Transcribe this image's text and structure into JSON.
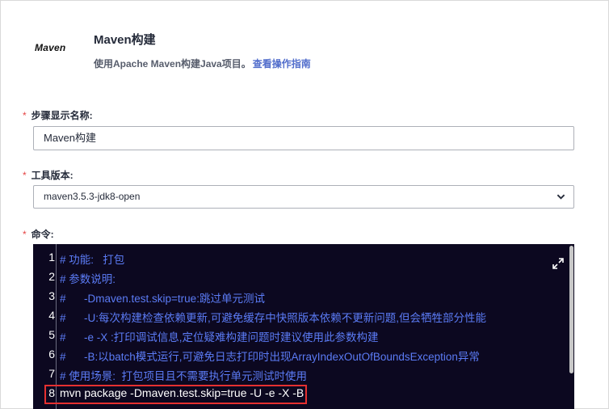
{
  "header": {
    "logo_text": "Maven",
    "title": "Maven构建",
    "description": "使用Apache Maven构建Java项目。",
    "guide_link": "查看操作指南"
  },
  "form": {
    "required_mark": "*",
    "step_name": {
      "label": "步骤显示名称:",
      "value": "Maven构建"
    },
    "tool_version": {
      "label": "工具版本:",
      "value": "maven3.5.3-jdk8-open"
    },
    "command": {
      "label": "命令:"
    }
  },
  "editor": {
    "line_numbers": [
      "1",
      "2",
      "3",
      "4",
      "5",
      "6",
      "7",
      "8"
    ],
    "lines": [
      "# 功能:   打包",
      "# 参数说明:",
      "#      -Dmaven.test.skip=true:跳过单元测试",
      "#      -U:每次构建检查依赖更新,可避免缓存中快照版本依赖不更新问题,但会牺牲部分性能",
      "#      -e -X :打印调试信息,定位疑难构建问题时建议使用此参数构建",
      "#      -B:以batch模式运行,可避免日志打印时出现ArrayIndexOutOfBoundsException异常",
      "# 使用场景:  打包项目且不需要执行单元测试时使用",
      "mvn package -Dmaven.test.skip=true -U -e -X -B"
    ],
    "comment_color": "#5b7bf5",
    "code_color": "#ffffff",
    "background_color": "#0c0820",
    "highlight_color": "#e53030"
  },
  "icons": {
    "expand": "expand-icon",
    "chevron": "chevron-down-icon"
  }
}
